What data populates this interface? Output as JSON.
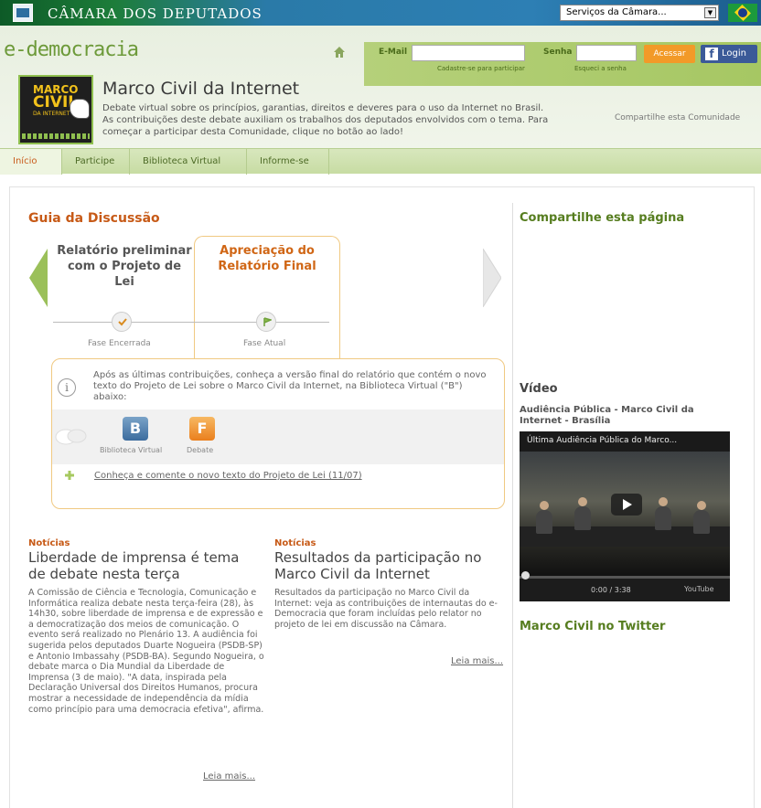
{
  "topbar": {
    "title": "CÂMARA DOS DEPUTADOS",
    "servicos_select": "Serviços da Câmara..."
  },
  "header": {
    "brand": "e-democracia",
    "email_label": "E-Mail",
    "cadastre_link": "Cadastre-se para participar",
    "senha_label": "Senha",
    "esqueci_link": "Esqueci a senha",
    "acessar_button": "Acessar",
    "login_button": "Login",
    "logo_line1": "MARCO",
    "logo_line2": "CIVIL",
    "logo_line3": "DA INTERNET",
    "page_title": "Marco Civil da Internet",
    "page_description": "Debate virtual sobre os princípios, garantias, direitos e deveres para o uso da Internet no Brasil. As contribuições deste debate auxiliam os trabalhos dos deputados envolvidos com o tema. Para começar a participar desta Comunidade, clique no botão ao lado!",
    "share_community": "Compartilhe esta Comunidade"
  },
  "nav": {
    "items": [
      "Início",
      "Participe",
      "Biblioteca Virtual",
      "Informe-se"
    ]
  },
  "guide": {
    "title": "Guia da Discussão",
    "phase1": "Relatório preliminar com o Projeto de Lei",
    "phase2": "Apreciação do Relatório Final",
    "phase1_status": "Fase Encerrada",
    "phase2_status": "Fase Atual",
    "info_text": "Após as últimas contribuições, conheça a versão final do relatório que contém o novo texto do Projeto de Lei sobre o Marco Civil da Internet, na Biblioteca Virtual (\"B\") abaixo:",
    "icon_b": "B",
    "icon_f": "F",
    "icon_b_label": "Biblioteca Virtual",
    "icon_f_label": "Debate",
    "conheca_link": "Conheça e comente o novo texto do Projeto de Lei (11/07)"
  },
  "news": [
    {
      "category": "Notícias",
      "title": "Liberdade de imprensa é tema de debate nesta terça",
      "body": "A Comissão de Ciência e Tecnologia, Comunicação e Informática realiza debate nesta terça-feira (28), às 14h30, sobre liberdade de imprensa e de expressão e a democratização dos meios de comunicação. O evento será realizado no Plenário 13. A audiência foi sugerida pelos deputados Duarte Nogueira (PSDB-SP) e Antonio Imbassahy (PSDB-BA). Segundo Nogueira, o debate marca o Dia Mundial da Liberdade de Imprensa (3 de maio). \"A data, inspirada pela Declaração Universal dos Direitos Humanos, procura mostrar a necessidade de independência da mídia como princípio para uma democracia efetiva\", afirma.",
      "more": "Leia mais..."
    },
    {
      "category": "Notícias",
      "title": "Resultados da participação no Marco Civil da Internet",
      "body": "Resultados da participação no Marco Civil da Internet: veja as contribuições de internautas do e-Democracia que foram incluídas pelo relator no projeto de lei em discussão na Câmara.",
      "more": "Leia mais..."
    }
  ],
  "sidebar": {
    "share_title": "Compartilhe esta página",
    "video_title": "Vídeo",
    "video_subtitle": "Audiência Pública - Marco Civil da Internet - Brasília",
    "video_overlay_title": "Última Audiência Pública do Marco...",
    "video_time": "0:00 / 3:38",
    "youtube_label": "YouTube",
    "twitter_title": "Marco Civil no Twitter"
  },
  "colors": {
    "accent_orange": "#c75a17",
    "accent_green": "#567d1f",
    "nav_green": "#c7dca3"
  }
}
